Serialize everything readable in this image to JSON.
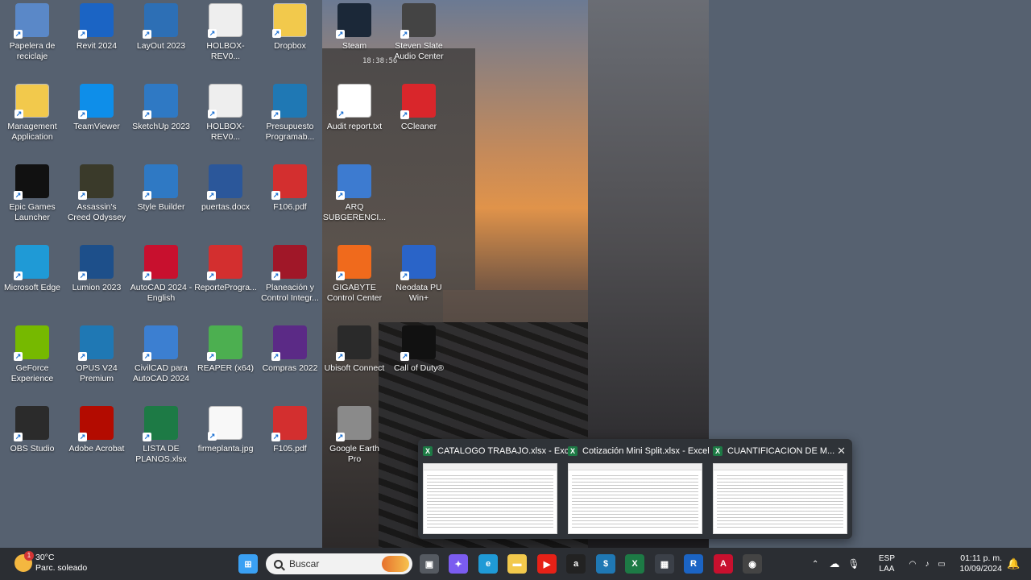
{
  "desktop": {
    "icons": [
      {
        "label": "Papelera de reciclaje",
        "icon": "recycle-bin-icon",
        "color": "#5a88c8"
      },
      {
        "label": "Revit 2024",
        "icon": "revit-icon",
        "color": "#1b64c4"
      },
      {
        "label": "LayOut 2023",
        "icon": "layout-icon",
        "color": "#2d6fb5"
      },
      {
        "label": "HOLBOX-REV0...",
        "icon": "file-thumbnail-icon",
        "color": "#eeeeee"
      },
      {
        "label": "Dropbox",
        "icon": "folder-icon",
        "color": "#f2c94c"
      },
      {
        "label": "Management Application",
        "icon": "folder-icon",
        "color": "#f2c94c"
      },
      {
        "label": "TeamViewer",
        "icon": "teamviewer-icon",
        "color": "#0e8ee9"
      },
      {
        "label": "SketchUp 2023",
        "icon": "sketchup-icon",
        "color": "#2f79c4"
      },
      {
        "label": "HOLBOX-REV0...",
        "icon": "file-thumbnail-icon",
        "color": "#eeeeee"
      },
      {
        "label": "Presupuesto Programab...",
        "icon": "dollar-app-icon",
        "color": "#1f78b4"
      },
      {
        "label": "Epic Games Launcher",
        "icon": "epic-games-icon",
        "color": "#111111"
      },
      {
        "label": "Assassin's Creed Odyssey",
        "icon": "game-icon",
        "color": "#3a3a2a"
      },
      {
        "label": "Style Builder",
        "icon": "style-builder-icon",
        "color": "#2f79c4"
      },
      {
        "label": "puertas.docx",
        "icon": "word-icon",
        "color": "#2b579a"
      },
      {
        "label": "F106.pdf",
        "icon": "pdf-icon",
        "color": "#d32f2f"
      },
      {
        "label": "Microsoft Edge",
        "icon": "edge-icon",
        "color": "#1f9ad6"
      },
      {
        "label": "Lumion 2023",
        "icon": "lumion-icon",
        "color": "#1d4f8a"
      },
      {
        "label": "AutoCAD 2024 - English",
        "icon": "autocad-icon",
        "color": "#c8102e"
      },
      {
        "label": "ReporteProgra...",
        "icon": "pdf-icon",
        "color": "#d32f2f"
      },
      {
        "label": "Planeación y Control Integr...",
        "icon": "clock-app-icon",
        "color": "#a01728"
      },
      {
        "label": "GeForce Experience",
        "icon": "nvidia-icon",
        "color": "#76b900"
      },
      {
        "label": "OPUS V24 Premium",
        "icon": "dollar-app-icon",
        "color": "#1f78b4"
      },
      {
        "label": "CivilCAD para AutoCAD 2024",
        "icon": "civilcad-icon",
        "color": "#3c7fd1"
      },
      {
        "label": "REAPER (x64)",
        "icon": "reaper-icon",
        "color": "#4caf50"
      },
      {
        "label": "Compras 2022",
        "icon": "cart-icon",
        "color": "#5b2a86"
      },
      {
        "label": "OBS Studio",
        "icon": "obs-icon",
        "color": "#2b2b2b"
      },
      {
        "label": "Adobe Acrobat",
        "icon": "acrobat-icon",
        "color": "#b30b00"
      },
      {
        "label": "LISTA DE PLANOS.xlsx",
        "icon": "excel-icon",
        "color": "#1d7a45"
      },
      {
        "label": "firmeplanta.jpg",
        "icon": "image-file-icon",
        "color": "#f8f8f8"
      },
      {
        "label": "F105.pdf",
        "icon": "pdf-icon",
        "color": "#d32f2f"
      },
      {
        "label": "Steam",
        "icon": "steam-icon",
        "color": "#1b2838"
      },
      {
        "label": "Steven Slate Audio Center",
        "icon": "audio-center-icon",
        "color": "#444444"
      },
      {
        "label": "Audit report.txt",
        "icon": "text-file-icon",
        "color": "#ffffff"
      },
      {
        "label": "CCleaner",
        "icon": "ccleaner-icon",
        "color": "#d9262b"
      },
      {
        "label": "ARQ SUBGERENCI...",
        "icon": "dwg-file-icon",
        "color": "#3d7bd0"
      },
      {
        "label": "GIGABYTE Control Center",
        "icon": "gigabyte-icon",
        "color": "#f06a1c"
      },
      {
        "label": "Neodata PU Win+",
        "icon": "neodata-icon",
        "color": "#2a64c8"
      },
      {
        "label": "Ubisoft Connect",
        "icon": "ubisoft-icon",
        "color": "#2a2a2a"
      },
      {
        "label": "Call of Duty®",
        "icon": "call-of-duty-icon",
        "color": "#111111"
      },
      {
        "label": "Google Earth Pro",
        "icon": "google-earth-icon",
        "color": "#8a8a8a"
      }
    ],
    "clock_overlay": "18:38:56"
  },
  "taskbar_thumbnails": {
    "items": [
      {
        "title": "CATALOGO TRABAJO.xlsx - Excel"
      },
      {
        "title": "Cotización Mini Split.xlsx - Excel"
      },
      {
        "title": "CUANTIFICACION DE M..."
      }
    ],
    "close_glyph": "✕"
  },
  "taskbar": {
    "weather_temp": "30°C",
    "weather_desc": "Parc. soleado",
    "weather_badge": "1",
    "search_placeholder": "Buscar",
    "apps": [
      {
        "icon": "windows-start-icon",
        "color": "#3aa0f3",
        "glyph": "⊞"
      },
      {
        "icon": "task-view-icon",
        "color": "#555a61",
        "glyph": "▣"
      },
      {
        "icon": "copilot-icon",
        "color": "#7b5cf0",
        "glyph": "✦"
      },
      {
        "icon": "edge-icon",
        "color": "#1f9ad6",
        "glyph": "e"
      },
      {
        "icon": "file-explorer-icon",
        "color": "#f2c94c",
        "glyph": "▬"
      },
      {
        "icon": "youtube-icon",
        "color": "#e62117",
        "glyph": "▶"
      },
      {
        "icon": "amazon-icon",
        "color": "#222222",
        "glyph": "a"
      },
      {
        "icon": "dollar-app-icon",
        "color": "#1f78b4",
        "glyph": "$"
      },
      {
        "icon": "excel-icon",
        "color": "#1d7a45",
        "glyph": "X"
      },
      {
        "icon": "calculator-icon",
        "color": "#3b4048",
        "glyph": "▦"
      },
      {
        "icon": "revit-icon",
        "color": "#1b64c4",
        "glyph": "R"
      },
      {
        "icon": "autocad-icon",
        "color": "#c8102e",
        "glyph": "A"
      },
      {
        "icon": "screen-record-icon",
        "color": "#444444",
        "glyph": "◉"
      }
    ],
    "lang_top": "ESP",
    "lang_bottom": "LAA",
    "time": "01:11 p. m.",
    "date": "10/09/2024"
  }
}
